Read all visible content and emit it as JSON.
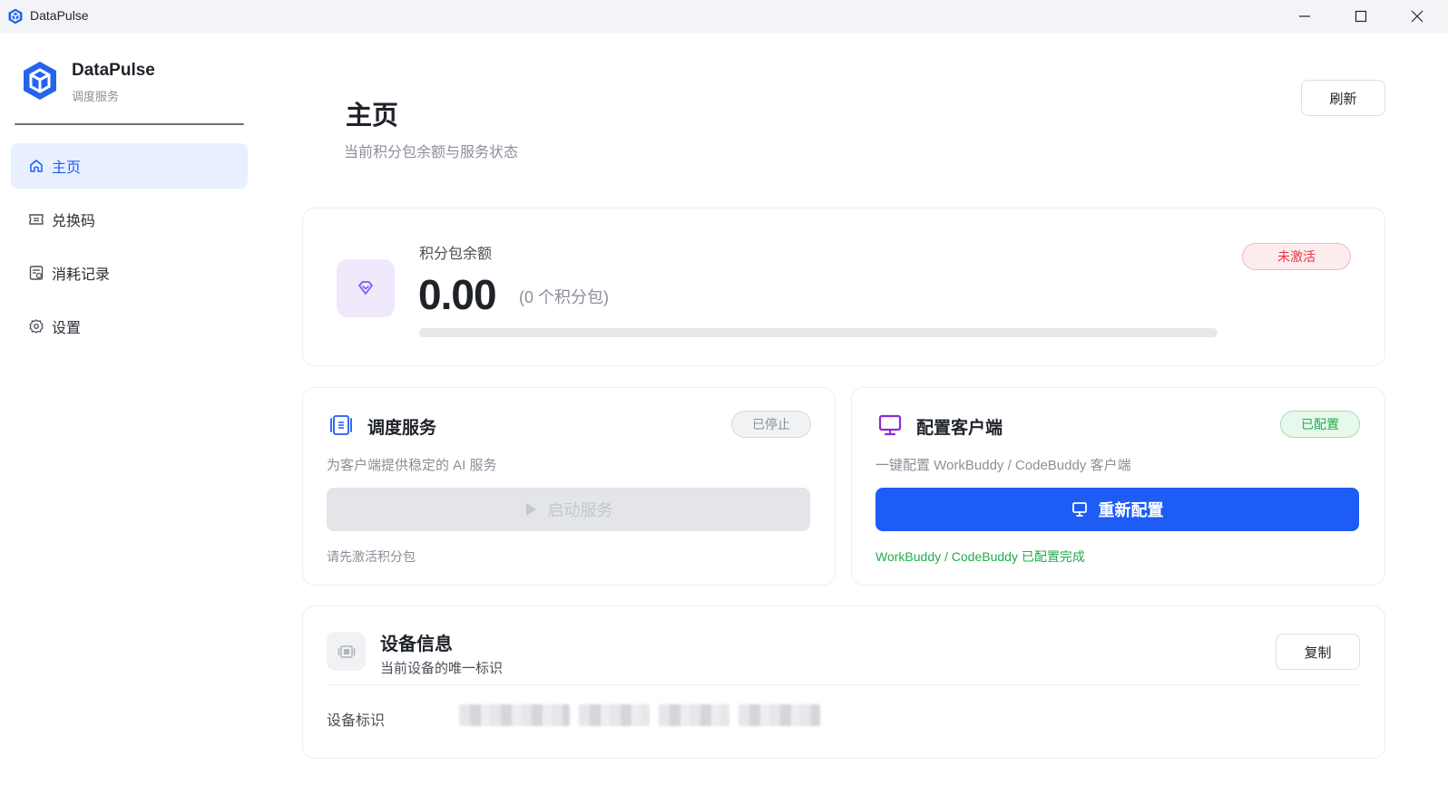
{
  "window": {
    "title": "DataPulse",
    "controls": [
      "minimize",
      "maximize",
      "close"
    ]
  },
  "sidebar": {
    "brand_name": "DataPulse",
    "brand_sub": "调度服务",
    "items": [
      {
        "label": "主页",
        "icon": "home-icon",
        "active": true
      },
      {
        "label": "兑换码",
        "icon": "ticket-icon",
        "active": false
      },
      {
        "label": "消耗记录",
        "icon": "receipt-icon",
        "active": false
      },
      {
        "label": "设置",
        "icon": "gear-icon",
        "active": false
      }
    ]
  },
  "header": {
    "title": "主页",
    "subtitle": "当前积分包余额与服务状态",
    "refresh_label": "刷新"
  },
  "balance": {
    "label": "积分包余额",
    "value": "0.00",
    "count": "(0 个积分包)",
    "status": "未激活",
    "progress": 0
  },
  "service": {
    "title": "调度服务",
    "status": "已停止",
    "description": "为客户端提供稳定的 AI 服务",
    "button_label": "启动服务",
    "note": "请先激活积分包"
  },
  "client": {
    "title": "配置客户端",
    "status": "已配置",
    "description": "一键配置 WorkBuddy / CodeBuddy 客户端",
    "button_label": "重新配置",
    "note": "WorkBuddy / CodeBuddy 已配置完成"
  },
  "device": {
    "title": "设备信息",
    "subtitle": "当前设备的唯一标识",
    "copy_label": "复制",
    "id_label": "设备标识"
  },
  "colors": {
    "accent": "#1d5cf5",
    "danger": "#e5353f",
    "success": "#1fad4c",
    "purple": "#7c5cf0"
  }
}
